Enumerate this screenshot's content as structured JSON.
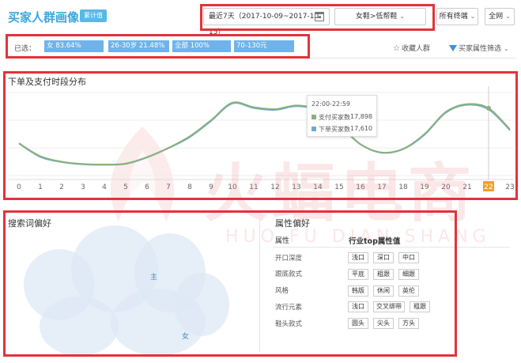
{
  "header": {
    "title": "买家人群画像",
    "badge": "累计值"
  },
  "controls": {
    "date_range": "最近7天（2017-10-09~2017-10-15）",
    "category": "女鞋>低帮鞋",
    "terminal": "所有终端",
    "network": "全网"
  },
  "filter_bar": {
    "selected_label": "已选：",
    "tags": [
      "女 83.64%",
      "26-30岁 21.48%",
      "全部 100%",
      "70-130元 23.29%"
    ],
    "favorite_label": "收藏人群",
    "attr_filter_label": "买家属性筛选"
  },
  "time_section": {
    "title": "下单及支付时段分布",
    "tooltip": {
      "time": "22:00-22:59",
      "rows": [
        {
          "label": "支付买家数",
          "value": "17,898",
          "color": "#8ab07a"
        },
        {
          "label": "下单买家数",
          "value": "17,610",
          "color": "#6fa8d6"
        }
      ]
    },
    "highlighted_tick": "22"
  },
  "chart_data": {
    "type": "line",
    "x": [
      0,
      1,
      2,
      3,
      4,
      5,
      6,
      7,
      8,
      9,
      10,
      11,
      12,
      13,
      14,
      15,
      16,
      17,
      18,
      19,
      20,
      21,
      22,
      23
    ],
    "series": [
      {
        "name": "支付买家数",
        "values": [
          13000,
          10200,
          9000,
          8500,
          8400,
          8600,
          10000,
          12000,
          14500,
          18000,
          21800,
          20800,
          20400,
          21200,
          20300,
          17000,
          12800,
          11000,
          11800,
          15000,
          19800,
          21500,
          20600,
          16000
        ]
      },
      {
        "name": "下单买家数",
        "values": [
          12900,
          10000,
          8900,
          8400,
          8300,
          8500,
          9900,
          11900,
          14300,
          17800,
          21600,
          20600,
          20200,
          21000,
          20100,
          16800,
          12700,
          10900,
          11700,
          14800,
          19600,
          21300,
          20300,
          15800
        ]
      }
    ],
    "ylim": [
      6000,
      24000
    ],
    "highlight_index": 22
  },
  "search_section": {
    "title": "搜索词偏好",
    "keywords": [
      "主",
      "女"
    ]
  },
  "attr_section": {
    "title": "属性偏好",
    "col_attr": "属性",
    "col_value": "行业top属性值",
    "rows": [
      {
        "label": "开口深度",
        "values": [
          "浅口",
          "深口",
          "中口"
        ]
      },
      {
        "label": "跟底款式",
        "values": [
          "平底",
          "粗跟",
          "细跟"
        ]
      },
      {
        "label": "风格",
        "values": [
          "韩版",
          "休闲",
          "英伦"
        ]
      },
      {
        "label": "流行元素",
        "values": [
          "浅口",
          "交叉绑带",
          "粗跟"
        ]
      },
      {
        "label": "鞋头款式",
        "values": [
          "圆头",
          "尖头",
          "方头"
        ]
      }
    ]
  },
  "watermark": {
    "cn": "火蝠电商",
    "en": "HUO FU DIAN SHANG"
  },
  "colors": {
    "accent": "#3aa6df",
    "highlight_box": "#e2333b",
    "tag_bg": "#6fb3ea",
    "line_pay": "#8ab07a",
    "line_order": "#6fa8d6",
    "tick_highlight": "#f0a030"
  }
}
